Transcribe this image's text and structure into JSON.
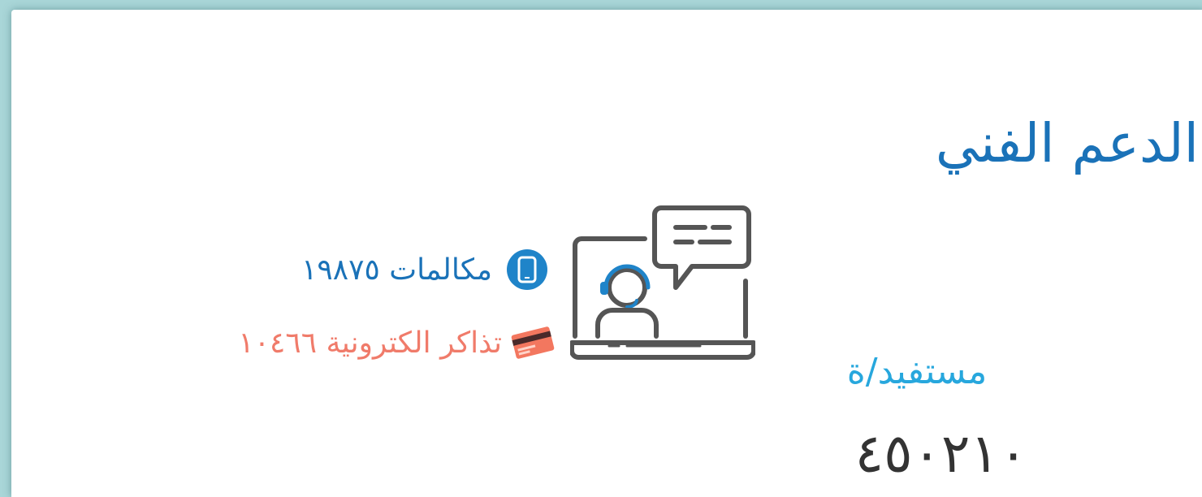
{
  "section": {
    "title": "الدعم الفني"
  },
  "beneficiaries": {
    "label": "مستفيد/ة",
    "count": "٤٥٠٢١٠"
  },
  "stats": {
    "calls": {
      "label": "مكالمات ١٩٨٧٥",
      "icon": "phone-icon",
      "color": "#1a72b8"
    },
    "tickets": {
      "label": "تذاكر الكترونية ١٠٤٦٦",
      "icon": "ticket-icon",
      "color": "#f07b6a"
    }
  },
  "illustration": {
    "icon": "support-agent-laptop-icon"
  },
  "colors": {
    "title": "#1a72b8",
    "beneficiary_label": "#27a7dd",
    "background_frame": "#a9d6d8"
  }
}
